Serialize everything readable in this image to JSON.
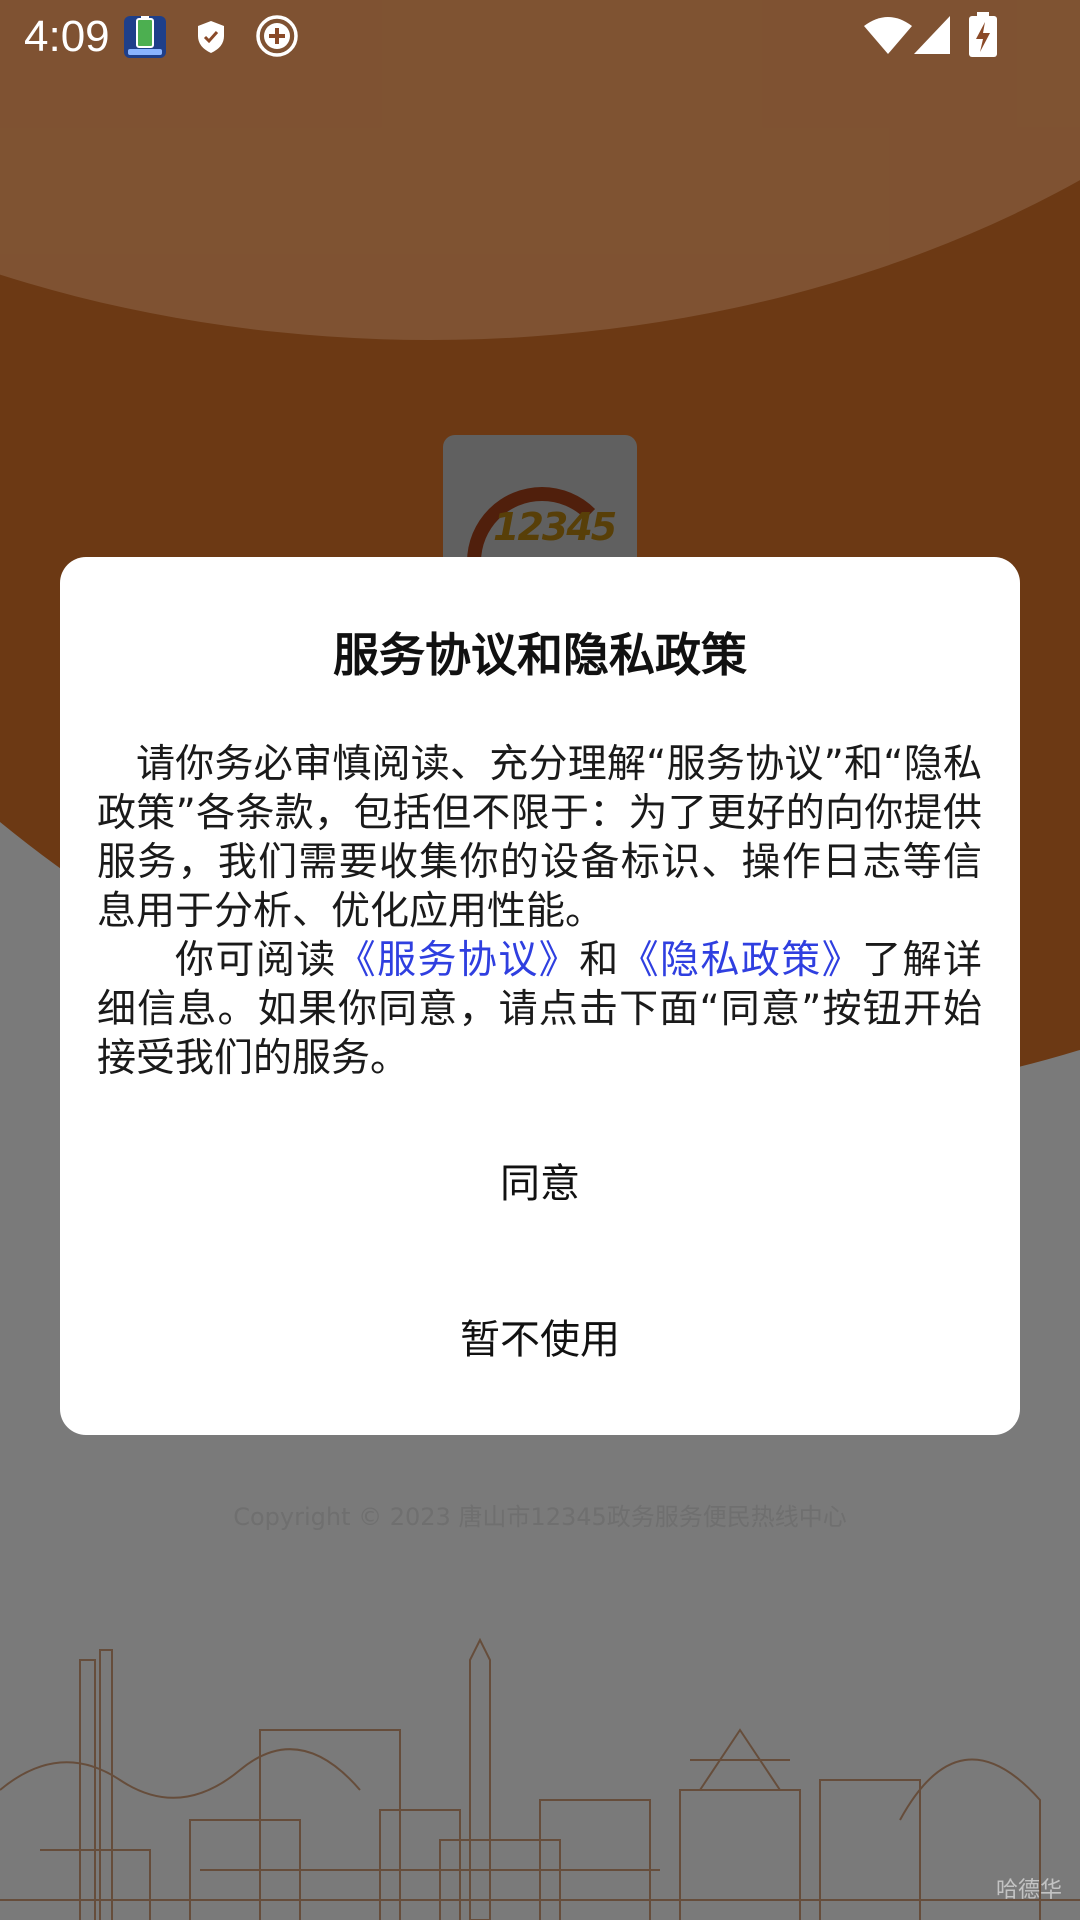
{
  "status_bar": {
    "time": "4:09",
    "icons": [
      "battery-app-icon",
      "shield-icon",
      "add-circle-icon",
      "wifi-icon",
      "signal-icon",
      "battery-charging-icon"
    ]
  },
  "splash": {
    "logo_text": "12345",
    "copyright": "Copyright © 2023 唐山市12345政务服务便民热线中心",
    "watermark": "哈德华"
  },
  "dialog": {
    "title": "服务协议和隐私政策",
    "paragraph1": "请你务必审慎阅读、充分理解“服务协议”和“隐私政策”各条款，包括但不限于：为了更好的向你提供服务，我们需要收集你的设备标识、操作日志等信息用于分析、优化应用性能。",
    "paragraph2_prefix": "你可阅读",
    "service_link": "《服务协议》",
    "paragraph2_and": "和",
    "privacy_link": "《隐私政策》",
    "paragraph2_suffix": "了解详细信息。如果你同意，请点击下面“同意”按钮开始接受我们的服务。",
    "agree_label": "同意",
    "decline_label": "暂不使用"
  },
  "colors": {
    "splash_orange": "#e2782a",
    "link_blue": "#2f3fe0",
    "dialog_bg": "#ffffff"
  }
}
